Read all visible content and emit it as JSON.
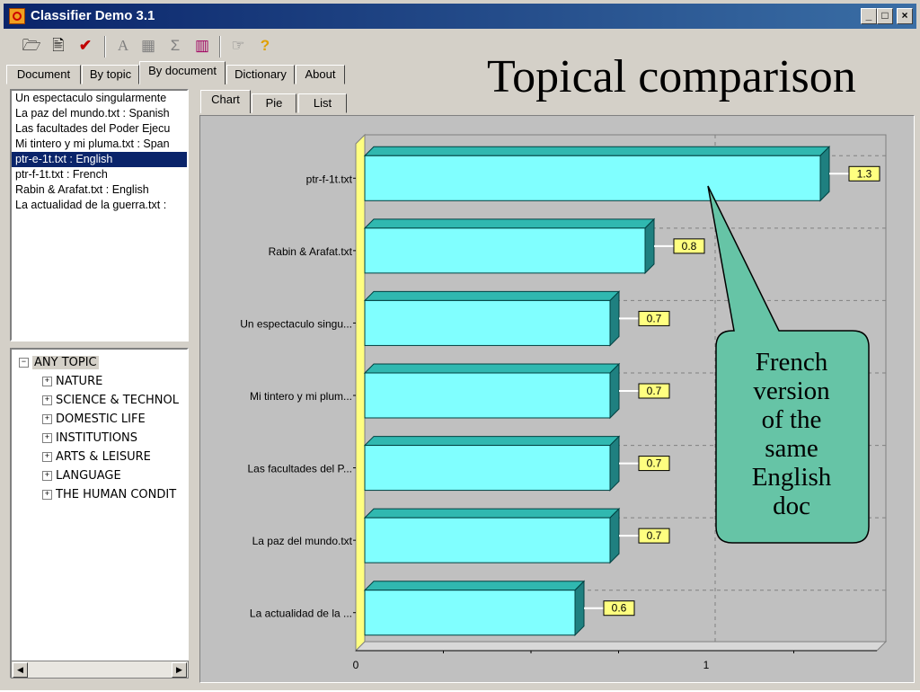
{
  "window": {
    "title": "Classifier Demo 3.1",
    "min_label": "_",
    "max_label": "□",
    "close_label": "×"
  },
  "toolbar": {
    "icons": [
      "open-folder-icon",
      "document-icon",
      "checkmark-icon",
      "font-icon",
      "copy-icon",
      "sigma-icon",
      "chart-icon",
      "pointer-icon",
      "help-icon"
    ]
  },
  "tabs": [
    {
      "label": "Document"
    },
    {
      "label": "By topic"
    },
    {
      "label": "By document"
    },
    {
      "label": "Dictionary"
    },
    {
      "label": "About"
    }
  ],
  "active_tab": "By document",
  "slide_title": "Topical comparison",
  "documents": [
    {
      "label": "Un espectaculo singularmente"
    },
    {
      "label": "La paz del mundo.txt : Spanish"
    },
    {
      "label": "Las facultades del Poder Ejecu"
    },
    {
      "label": "Mi tintero y mi pluma.txt : Span"
    },
    {
      "label": "ptr-e-1t.txt : English"
    },
    {
      "label": "ptr-f-1t.txt : French"
    },
    {
      "label": "Rabin & Arafat.txt : English"
    },
    {
      "label": "La actualidad de la guerra.txt :"
    }
  ],
  "selected_document": "ptr-e-1t.txt : English",
  "topics": {
    "root": {
      "label": "ANY TOPIC",
      "toggle": "−"
    },
    "children": [
      {
        "label": "NATURE",
        "toggle": "+"
      },
      {
        "label": "SCIENCE & TECHNOL",
        "toggle": "+"
      },
      {
        "label": "DOMESTIC LIFE",
        "toggle": "+"
      },
      {
        "label": "INSTITUTIONS",
        "toggle": "+"
      },
      {
        "label": "ARTS & LEISURE",
        "toggle": "+"
      },
      {
        "label": "LANGUAGE",
        "toggle": "+"
      },
      {
        "label": "THE HUMAN CONDIT",
        "toggle": "+"
      }
    ]
  },
  "chart_tabs": [
    {
      "label": "Chart"
    },
    {
      "label": "Pie"
    },
    {
      "label": "List"
    }
  ],
  "active_chart_tab": "Chart",
  "colors": {
    "bar_front": "#80ffff",
    "bar_top": "#30b8b0",
    "bar_side": "#1f8080",
    "label_bg": "#ffff80",
    "callout": "#66c4a6",
    "selection": "#0a246a"
  },
  "chart_data": {
    "type": "bar",
    "orientation": "horizontal",
    "categories": [
      "ptr-f-1t.txt",
      "Rabin & Arafat.txt",
      "Un espectaculo singu...",
      "Mi tintero y mi plum...",
      "Las facultades del P...",
      "La paz del mundo.txt",
      "La actualidad de la ..."
    ],
    "values": [
      1.3,
      0.8,
      0.7,
      0.7,
      0.7,
      0.7,
      0.6
    ],
    "value_labels": [
      "1.3",
      "0.8",
      "0.7",
      "0.7",
      "0.7",
      "0.7",
      "0.6"
    ],
    "x_ticks": [
      0,
      1
    ],
    "x_tick_labels": [
      "0",
      "1"
    ],
    "xlim": [
      0,
      1.5
    ],
    "grid": true,
    "style": "3d"
  },
  "callout": {
    "lines": [
      "French",
      "version",
      "of the",
      "same",
      "English",
      "doc"
    ]
  },
  "scrollbar": {
    "left_arrow": "◀",
    "right_arrow": "▶"
  }
}
